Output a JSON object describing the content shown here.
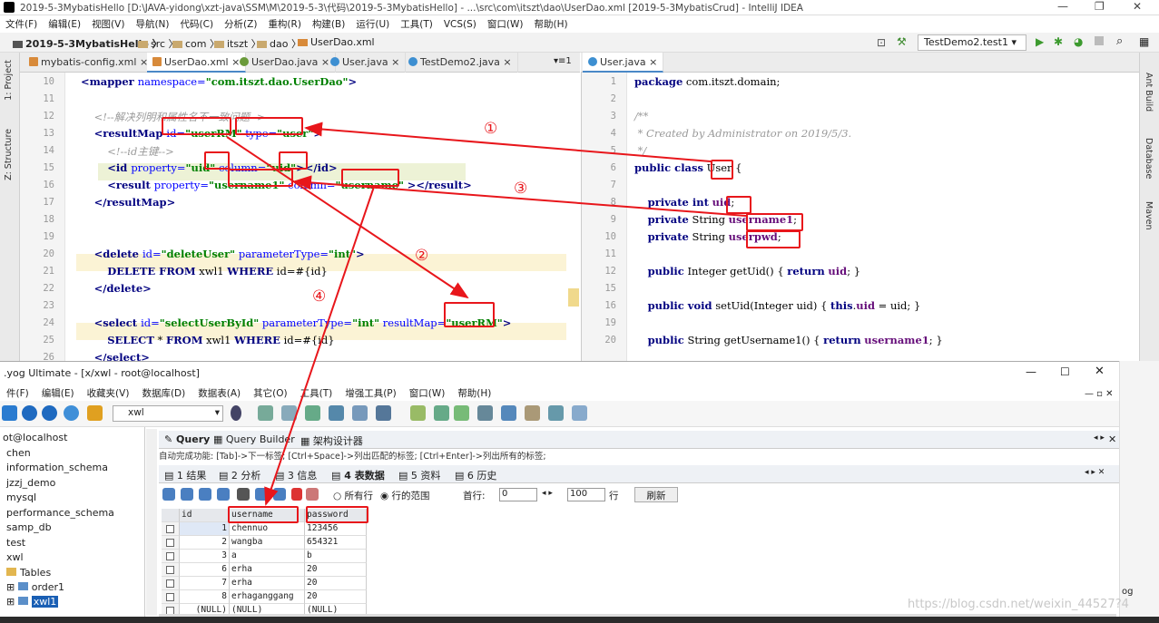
{
  "ide": {
    "title": "2019-5-3MybatisHello [D:\\JAVA-yidong\\xzt-java\\SSM\\M\\2019-5-3\\代码\\2019-5-3MybatisHello] - ...\\src\\com\\itszt\\dao\\UserDao.xml [2019-5-3MybatisCrud] - IntelliJ IDEA",
    "menu": [
      "文件(F)",
      "编辑(E)",
      "视图(V)",
      "导航(N)",
      "代码(C)",
      "分析(Z)",
      "重构(R)",
      "构建(B)",
      "运行(U)",
      "工具(T)",
      "VCS(S)",
      "窗口(W)",
      "帮助(H)"
    ],
    "breadcrumb": [
      "2019-5-3MybatisHello",
      "src",
      "com",
      "itszt",
      "dao",
      "UserDao.xml"
    ],
    "run_config": "TestDemo2.test1",
    "left_vtabs": [
      "1: Project",
      "Z: Structure"
    ],
    "right_vtabs": [
      "Ant Build",
      "Database",
      "Maven"
    ],
    "tabs_left": [
      "mybatis-config.xml",
      "UserDao.xml",
      "UserDao.java",
      "User.java",
      "TestDemo2.java"
    ],
    "tabs_overflow": "▾≡1",
    "tabs_right": [
      "User.java"
    ],
    "xml_lines": [
      {
        "n": "10",
        "html": "<span class='tg'>&lt;mapper </span><span class='at'>namespace=</span><span class='vl'>\"com.itszt.dao.UserDao\"</span><span class='tg'>&gt;</span>"
      },
      {
        "n": "11",
        "html": ""
      },
      {
        "n": "12",
        "html": "    <span class='cm'>&lt;!--解决列明和属性名不一致问题--&gt;</span>"
      },
      {
        "n": "13",
        "html": "    <span class='tg'>&lt;resultMap </span><span class='at'>id=</span><span class='vl'>\"userRM\"</span> <span class='at'>type=</span><span class='vl'>\"user\"</span><span class='tg'>&gt;</span>"
      },
      {
        "n": "14",
        "html": "        <span class='cm'>&lt;!--id主键--&gt;</span>"
      },
      {
        "n": "15",
        "html": "        <span class='tg'>&lt;id </span><span class='at'>property=</span><span class='vl'>\"uid\"</span> <span class='at'>column=</span><span class='vl'>\"uid\"</span><span class='tg'>&gt;&lt;/id&gt;</span>"
      },
      {
        "n": "16",
        "html": "        <span class='tg'>&lt;result </span><span class='at'>property=</span><span class='vl'>\"username1\"</span> <span class='at'>column=</span><span class='vl'>\"username\"</span> <span class='tg'>&gt;&lt;/result&gt;</span>"
      },
      {
        "n": "17",
        "html": "    <span class='tg'>&lt;/resultMap&gt;</span>"
      },
      {
        "n": "18",
        "html": ""
      },
      {
        "n": "19",
        "html": ""
      },
      {
        "n": "20",
        "html": "    <span class='tg'>&lt;delete </span><span class='at'>id=</span><span class='vl'>\"deleteUser\"</span> <span class='at'>parameterType=</span><span class='vl'>\"int\"</span><span class='tg'>&gt;</span>"
      },
      {
        "n": "21",
        "html": "        <span class='kw'>DELETE FROM</span> xwl1 <span class='kw'>WHERE</span> id=#{id}"
      },
      {
        "n": "22",
        "html": "    <span class='tg'>&lt;/delete&gt;</span>"
      },
      {
        "n": "23",
        "html": ""
      },
      {
        "n": "24",
        "html": "    <span class='tg'>&lt;select </span><span class='at'>id=</span><span class='vl'>\"selectUserById\"</span> <span class='at'>parameterType=</span><span class='vl'>\"int\"</span> <span class='at'>resultMap=</span><span class='vl'>\"userRM\"</span><span class='tg'>&gt;</span>"
      },
      {
        "n": "25",
        "html": "        <span class='kw'>SELECT</span> * <span class='kw'>FROM</span> xwl1 <span class='kw'>WHERE</span> id=#{id}"
      },
      {
        "n": "26",
        "html": "    <span class='tg'>&lt;/select&gt;</span>"
      }
    ],
    "java_lines": [
      {
        "n": "1",
        "html": "<span class='kw'>package</span> com.itszt.domain;"
      },
      {
        "n": "2",
        "html": ""
      },
      {
        "n": "3",
        "html": "<span class='cm'>/**</span>"
      },
      {
        "n": "4",
        "html": "<span class='cm'> * Created by Administrator on 2019/5/3.</span>"
      },
      {
        "n": "5",
        "html": "<span class='cm'> */</span>"
      },
      {
        "n": "6",
        "html": "<span class='kw'>public class</span> User {"
      },
      {
        "n": "7",
        "html": ""
      },
      {
        "n": "8",
        "html": "    <span class='kw'>private int</span> <span class='fd'>uid</span>;"
      },
      {
        "n": "9",
        "html": "    <span class='kw'>private</span> String <span class='fd'>username1</span>;"
      },
      {
        "n": "10",
        "html": "    <span class='kw'>private</span> String <span class='fd'>userpwd</span>;"
      },
      {
        "n": "11",
        "html": ""
      },
      {
        "n": "12",
        "html": "    <span class='kw'>public</span> Integer getUid() { <span class='kw'>return</span> <span class='fd'>uid</span>; }"
      },
      {
        "n": "15",
        "html": ""
      },
      {
        "n": "16",
        "html": "    <span class='kw'>public void</span> setUid(Integer uid) { <span class='kw'>this</span>.<span class='fd'>uid</span> = uid; }"
      },
      {
        "n": "19",
        "html": ""
      },
      {
        "n": "20",
        "html": "    <span class='kw'>public</span> String getUsername1() { <span class='kw'>return</span> <span class='fd'>username1</span>; }"
      }
    ]
  },
  "sqlyog": {
    "title": ".yog Ultimate - [x/xwl - root@localhost]",
    "menu": [
      "件(F)",
      "编辑(E)",
      "收藏夹(V)",
      "数据库(D)",
      "数据表(A)",
      "其它(O)",
      "工具(T)",
      "增强工具(P)",
      "窗口(W)",
      "帮助(H)"
    ],
    "db_selector": "xwl",
    "tree": [
      "ot@localhost",
      "chen",
      "information_schema",
      "jzzj_demo",
      "mysql",
      "performance_schema",
      "samp_db",
      "test",
      "xwl",
      "Tables",
      "order1",
      "xwl1"
    ],
    "query_tabs": [
      "Query",
      "Query Builder",
      "架构设计器"
    ],
    "hint": "自动完成功能: [Tab]->下一标签; [Ctrl+Space]->列出匹配的标签; [Ctrl+Enter]->列出所有的标签;",
    "result_tabs": [
      "1 结果",
      "2 分析",
      "3 信息",
      "4 表数据",
      "5 资料",
      "6 历史"
    ],
    "grid_controls": {
      "all_rows": "所有行",
      "range": "行的范围",
      "first_row_label": "首行:",
      "first_row": "0",
      "count": "100",
      "row_unit": "行",
      "refresh": "刷新"
    },
    "columns": [
      "id",
      "username",
      "password"
    ],
    "rows": [
      [
        "1",
        "chennuo",
        "123456"
      ],
      [
        "2",
        "wangba",
        "654321"
      ],
      [
        "3",
        "a",
        "b"
      ],
      [
        "6",
        "erha",
        "20"
      ],
      [
        "7",
        "erha",
        "20"
      ],
      [
        "8",
        "erhaganggang",
        "20"
      ],
      [
        "(NULL)",
        "(NULL)",
        "(NULL)"
      ]
    ],
    "side_label": "og"
  },
  "annotations": [
    "①",
    "②",
    "③",
    "④"
  ],
  "watermark": "https://blog.csdn.net/weixin_44527?4",
  "colors": {
    "annotation": "#e8161b",
    "xml_tag": "#000080",
    "xml_value": "#008000"
  }
}
